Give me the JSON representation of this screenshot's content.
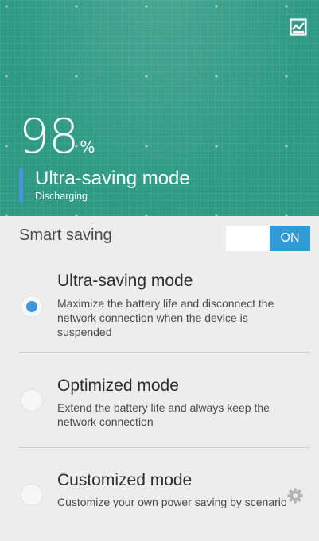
{
  "header": {
    "battery_percent": "98",
    "percent_sign": "%",
    "mode_title": "Ultra-saving mode",
    "status": "Discharging",
    "icons": {
      "chart": "usage-chart-icon"
    },
    "colors": {
      "background": "#2e9a84",
      "mode_indicator": "#4a8fe8"
    }
  },
  "smart_saving": {
    "label": "Smart saving",
    "toggle_state": "ON",
    "colors": {
      "toggle_on": "#2f9bd8"
    }
  },
  "options": [
    {
      "title": "Ultra-saving mode",
      "description": "Maximize the battery life and disconnect the network connection when the device is suspended",
      "selected": true
    },
    {
      "title": "Optimized mode",
      "description": "Extend the battery life and always keep the network connection",
      "selected": false
    },
    {
      "title": "Customized mode",
      "description": "Customize your own power saving by scenario",
      "selected": false,
      "settings_icon": "gear-icon"
    }
  ]
}
